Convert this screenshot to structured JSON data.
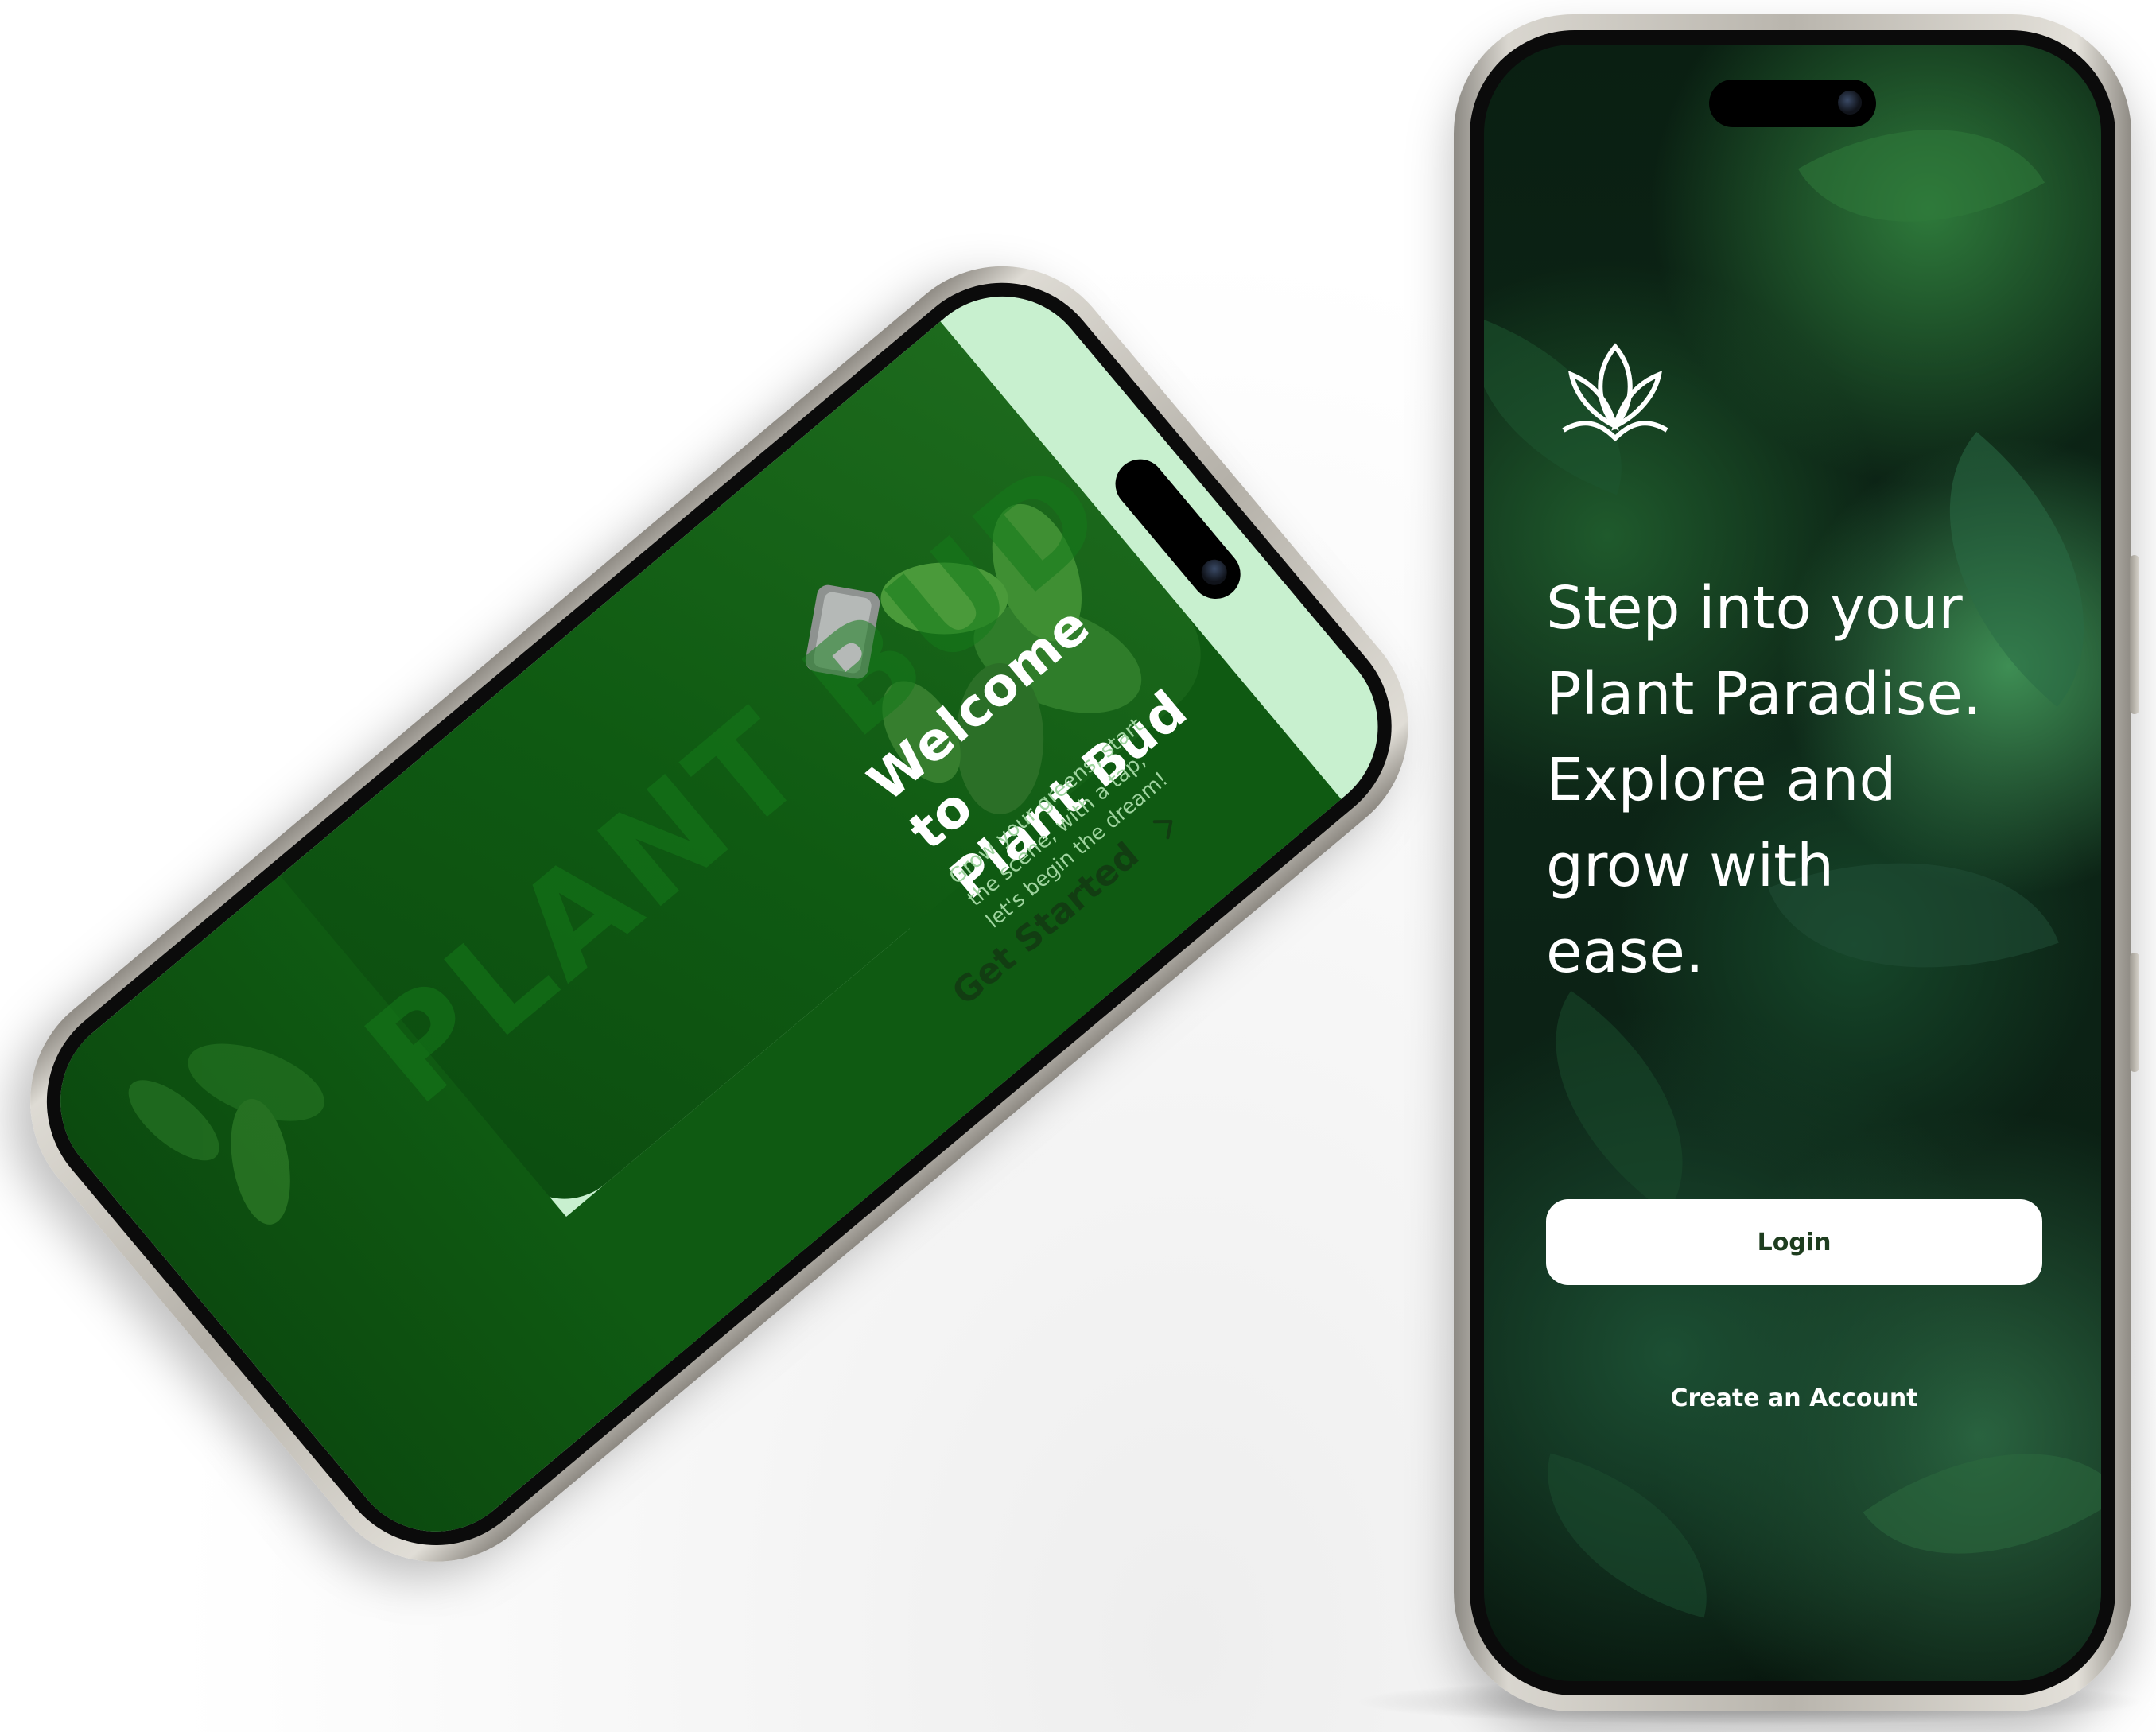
{
  "onboarding_screen": {
    "title": "Welcome to\nPlant Bud",
    "subtitle": "Grow your greens, start the scene, with a tap, let's begin the dream!",
    "cta_label": "Get Started",
    "watermark": "PLANT BUD"
  },
  "login_screen": {
    "headline": "Step into your\nPlant Paradise.\nExplore and\ngrow with\nease.",
    "login_label": "Login",
    "create_account_label": "Create an Account",
    "logo_icon": "lotus-leaf-icon"
  },
  "colors": {
    "brand_green": "#0f5a12",
    "mint_background": "#c8f0cf",
    "dark_foliage": "#0b2014",
    "button_white": "#ffffff"
  }
}
